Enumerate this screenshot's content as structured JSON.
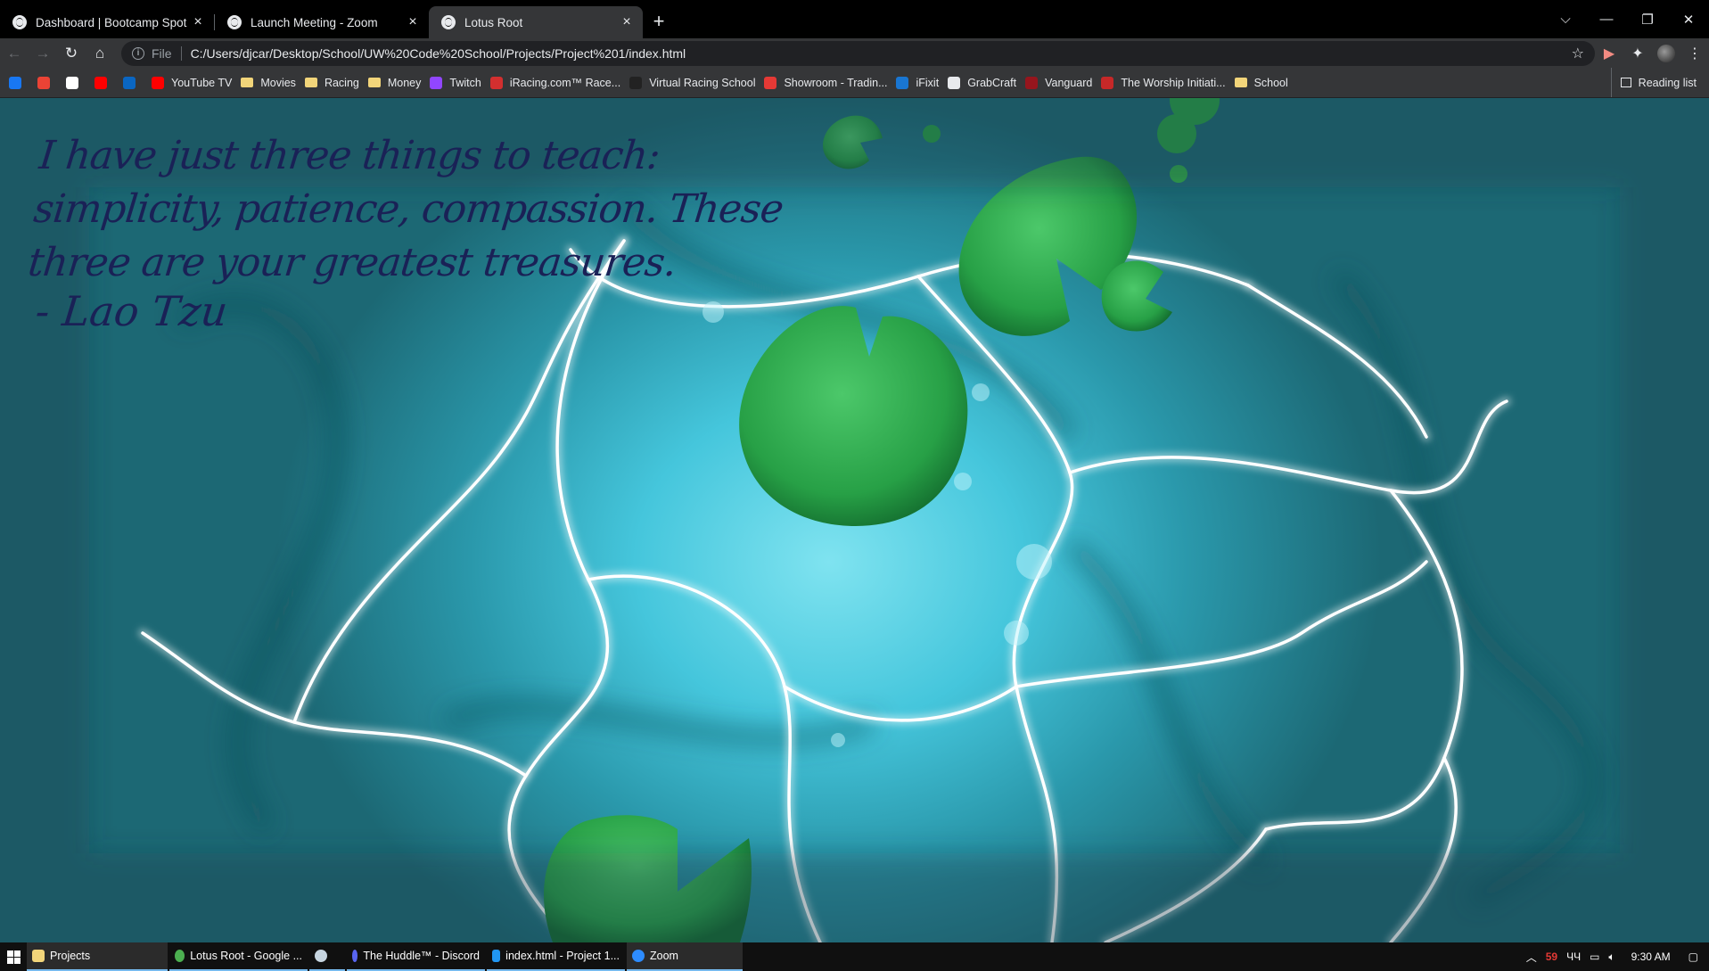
{
  "browser": {
    "tabs": [
      {
        "title": "Dashboard | Bootcamp Spot",
        "active": false
      },
      {
        "title": "Launch Meeting - Zoom",
        "active": false
      },
      {
        "title": "Lotus Root",
        "active": true
      }
    ],
    "new_tab_icon": "plus-icon",
    "window_controls": [
      "chevron-down-icon",
      "minimize-icon",
      "restore-icon",
      "close-icon"
    ],
    "address_bar": {
      "scheme_label": "File",
      "url": "C:/Users/djcar/Desktop/School/UW%20Code%20School/Projects/Project%201/index.html"
    },
    "bookmarks": [
      {
        "label": "",
        "icon": "facebook-icon",
        "color": "#1877f2"
      },
      {
        "label": "",
        "icon": "gmail-icon",
        "color": "#ea4335"
      },
      {
        "label": "",
        "icon": "amazon-icon",
        "color": "#ffffff"
      },
      {
        "label": "",
        "icon": "youtube-icon",
        "color": "#ff0000"
      },
      {
        "label": "",
        "icon": "linkedin-icon",
        "color": "#0a66c2"
      },
      {
        "label": "YouTube TV",
        "icon": "youtube-tv-icon",
        "color": "#ff0000"
      },
      {
        "label": "Movies",
        "icon": "folder-icon"
      },
      {
        "label": "Racing",
        "icon": "folder-icon"
      },
      {
        "label": "Money",
        "icon": "folder-icon"
      },
      {
        "label": "Twitch",
        "icon": "twitch-icon",
        "color": "#9146ff"
      },
      {
        "label": "iRacing.com™ Race...",
        "icon": "iracing-icon",
        "color": "#d32f2f"
      },
      {
        "label": "Virtual Racing School",
        "icon": "vrs-icon",
        "color": "#222222"
      },
      {
        "label": "Showroom - Tradin...",
        "icon": "showroom-icon",
        "color": "#e53935"
      },
      {
        "label": "iFixit",
        "icon": "ifixit-icon",
        "color": "#1976d2"
      },
      {
        "label": "GrabCraft",
        "icon": "globe-icon",
        "color": "#e8eaed"
      },
      {
        "label": "Vanguard",
        "icon": "vanguard-icon",
        "color": "#96151d"
      },
      {
        "label": "The Worship Initiati...",
        "icon": "worship-icon",
        "color": "#c62828"
      },
      {
        "label": "School",
        "icon": "folder-icon"
      }
    ],
    "reading_list": "Reading list"
  },
  "page": {
    "quote": "I have just three things to teach: simplicity, patience, compassion. These three are your greatest treasures.",
    "author": "- Lao Tzu",
    "colors": {
      "text": "#1a2156",
      "water": "#45c6dc",
      "lily_pad": "#2fa84a"
    }
  },
  "taskbar": {
    "items": [
      {
        "label": "Projects",
        "icon": "folder-icon",
        "color": "#f2d57a"
      },
      {
        "label": "Lotus Root - Google ...",
        "icon": "chrome-icon",
        "color": "#4caf50"
      },
      {
        "label": "",
        "icon": "steam-icon",
        "color": "#c7d5e0"
      },
      {
        "label": "The Huddle™ - Discord",
        "icon": "discord-icon",
        "color": "#5865f2"
      },
      {
        "label": "index.html - Project 1...",
        "icon": "vscode-icon",
        "color": "#2196f3"
      },
      {
        "label": "Zoom",
        "icon": "zoom-icon",
        "color": "#2d8cff"
      }
    ],
    "tray": {
      "badge": "59",
      "lang": "ЧЧ",
      "time": "9:30 AM"
    }
  }
}
